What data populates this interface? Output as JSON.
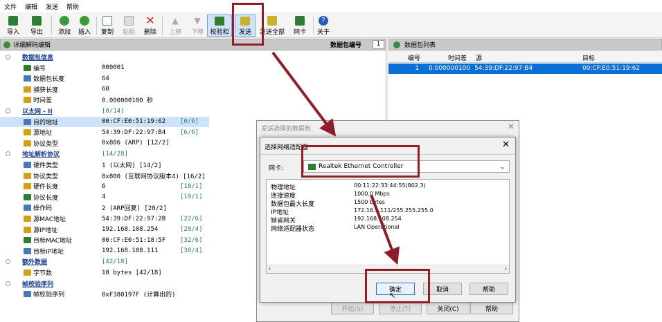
{
  "menu": [
    "文件",
    "编辑",
    "发送",
    "帮助"
  ],
  "toolbar": {
    "import": "导入",
    "export": "导出",
    "add": "添加",
    "insert": "插入",
    "copy": "复制",
    "paste": "粘贴",
    "delete": "删除",
    "up": "上移",
    "down": "下移",
    "checksum": "校验和",
    "send": "发送",
    "send_all": "发送全部",
    "nic": "网卡",
    "about": "关于"
  },
  "left_header": "详细解码编辑",
  "packet_no_label": "数据包编号",
  "packet_no_value": "1",
  "tree": [
    {
      "label": "数据包信息",
      "value": "",
      "extra": "",
      "group": true
    },
    {
      "label": "编号",
      "value": "000001",
      "extra": ""
    },
    {
      "label": "数据包长度",
      "value": "64",
      "extra": ""
    },
    {
      "label": "捕获长度",
      "value": "60",
      "extra": ""
    },
    {
      "label": "时间差",
      "value": "0.000000100 秒",
      "extra": ""
    },
    {
      "label": "以太网 - II",
      "value": "[0/14]",
      "extra": "",
      "group": true
    },
    {
      "label": "目的地址",
      "value": "00:CF:E0:51:19:62",
      "extra": "[0/6]"
    },
    {
      "label": "源地址",
      "value": "54:39:DF:22:97:B4",
      "extra": "[6/6]"
    },
    {
      "label": "协议类型",
      "value": "0x806  (ARP)  [12/2]",
      "extra": ""
    },
    {
      "label": "地址解析协议",
      "value": "[14/28]",
      "extra": "",
      "group": true
    },
    {
      "label": "硬件类型",
      "value": "1  (以太网)  [14/2]",
      "extra": ""
    },
    {
      "label": "协议类型",
      "value": "0x800  (互联网协议版本4)  [16/2]",
      "extra": ""
    },
    {
      "label": "硬件长度",
      "value": "6",
      "extra": "[18/1]"
    },
    {
      "label": "协议长度",
      "value": "4",
      "extra": "[19/1]"
    },
    {
      "label": "操作码",
      "value": "2  (ARP回复)  [20/2]",
      "extra": ""
    },
    {
      "label": "源MAC地址",
      "value": "54:39:DF:22:97:2B",
      "extra": "[22/6]"
    },
    {
      "label": "源IP地址",
      "value": "192.168.108.254",
      "extra": "[28/4]"
    },
    {
      "label": "目标MAC地址",
      "value": "00:CF:E0:51:18:5F",
      "extra": "[32/6]"
    },
    {
      "label": "目标IP地址",
      "value": "192.168.108.111",
      "extra": "[38/4]"
    },
    {
      "label": "额外数据",
      "value": "[42/18]",
      "extra": "",
      "group": true
    },
    {
      "label": "字节数",
      "value": "18 bytes   [42/18]",
      "extra": ""
    },
    {
      "label": "帧校验序列",
      "value": "",
      "extra": "",
      "group": true
    },
    {
      "label": "帧校验序列",
      "value": "0xF380197F   (计算出的)",
      "extra": ""
    }
  ],
  "right_header": "数据包列表",
  "list": {
    "columns": [
      "编号",
      "时间差",
      "源",
      "目标"
    ],
    "rows": [
      [
        "1",
        "0.000000100",
        "54:39:DF:22:97:B4",
        "00:CF:E0:51:19:62"
      ]
    ]
  },
  "outer_dialog": {
    "title": "发送选择的数据包",
    "buttons": [
      "开始(S)",
      "停止(T)",
      "关闭(C)",
      "帮助"
    ]
  },
  "inner_dialog": {
    "title": "选择网络适配器",
    "nic_label": "网卡:",
    "nic_value": "Realtek Ethernet Controller",
    "info_labels": [
      "物理地址",
      "连接速度",
      "数据包最大长度",
      "IP地址",
      "缺省网关",
      "网络适配器状态"
    ],
    "info_values": [
      "00:11:22:33:44:55(802.3)",
      "1000.0 Mbps",
      "1500 bytes",
      "172.16.1.111/255.255.255.0",
      "192.168.108.254",
      "LAN Operational"
    ],
    "ok": "确定",
    "cancel": "取消",
    "help": "帮助"
  },
  "colors": {
    "highlight": "#0a6fd6",
    "annotation": "#8e1f2a",
    "group_text": "#1a3f8f"
  }
}
